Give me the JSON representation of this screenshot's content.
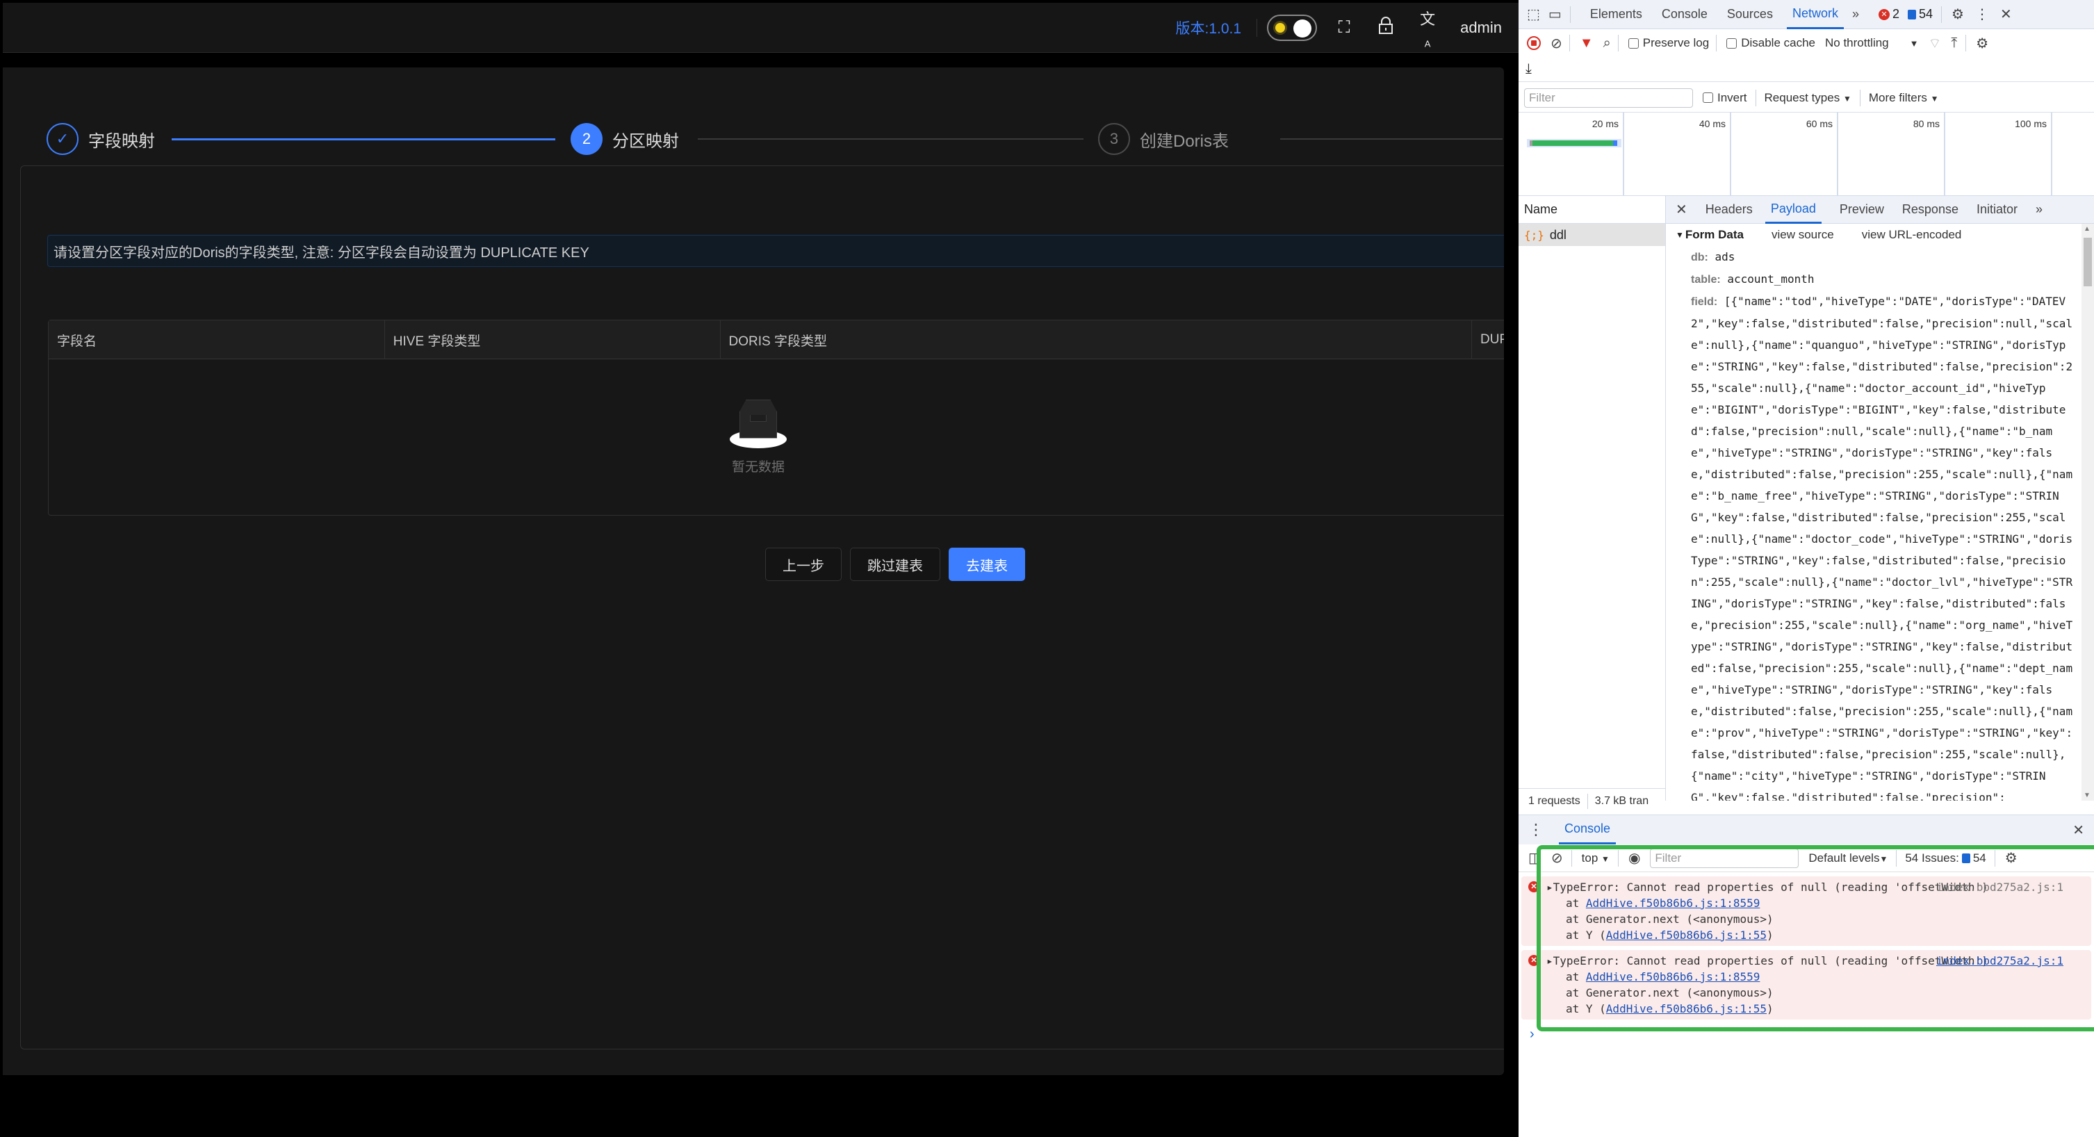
{
  "app": {
    "header": {
      "version": "版本:1.0.1",
      "theme_toggle": "light",
      "icons": [
        "fullscreen-icon",
        "lock-icon",
        "translate-icon"
      ],
      "user": "admin"
    },
    "steps": [
      {
        "index": "1",
        "label": "字段映射",
        "status": "done"
      },
      {
        "index": "2",
        "label": "分区映射",
        "status": "active"
      },
      {
        "index": "3",
        "label": "创建Doris表",
        "status": "wait"
      }
    ],
    "alert": "请设置分区字段对应的Doris的字段类型, 注意: 分区字段会自动设置为 DUPLICATE KEY",
    "table": {
      "columns": [
        "字段名",
        "HIVE 字段类型",
        "DORIS 字段类型",
        "DUPLICATE KEY"
      ],
      "rows": [],
      "empty_text": "暂无数据"
    },
    "buttons": {
      "prev": "上一步",
      "skip": "跳过建表",
      "create": "去建表"
    },
    "colors": {
      "primary": "#3c7eff",
      "background": "#171717"
    }
  },
  "devtools": {
    "tabs": [
      "Elements",
      "Console",
      "Sources",
      "Network"
    ],
    "active_tab": "Network",
    "more": "»",
    "errors_count": "2",
    "issues_count": "54",
    "toolbar": {
      "preserve_log": "Preserve log",
      "disable_cache": "Disable cache",
      "throttling": "No throttling"
    },
    "filterbar": {
      "filter_placeholder": "Filter",
      "invert": "Invert",
      "request_types": "Request types",
      "more_filters": "More filters"
    },
    "timeline": {
      "ticks": [
        "20 ms",
        "40 ms",
        "60 ms",
        "80 ms",
        "100 ms"
      ]
    },
    "requests": {
      "header": "Name",
      "items": [
        {
          "name": "ddl",
          "icon": "xhr-icon"
        }
      ],
      "status_count": "1 requests",
      "status_size": "3.7 kB tran"
    },
    "detail": {
      "tabs": [
        "Headers",
        "Payload",
        "Preview",
        "Response",
        "Initiator"
      ],
      "active_tab": "Payload",
      "form_data_title": "Form Data",
      "view_source": "view source",
      "view_url_encoded": "view URL-encoded",
      "db_key": "db:",
      "db_value": "ads",
      "table_key": "table:",
      "table_value": "account_month",
      "field_key": "field:",
      "field_value": "[{\"name\":\"tod\",\"hiveType\":\"DATE\",\"dorisType\":\"DATEV2\",\"key\":false,\"distributed\":false,\"precision\":null,\"scale\":null},{\"name\":\"quanguo\",\"hiveType\":\"STRING\",\"dorisType\":\"STRING\",\"key\":false,\"distributed\":false,\"precision\":255,\"scale\":null},{\"name\":\"doctor_account_id\",\"hiveType\":\"BIGINT\",\"dorisType\":\"BIGINT\",\"key\":false,\"distributed\":false,\"precision\":null,\"scale\":null},{\"name\":\"b_name\",\"hiveType\":\"STRING\",\"dorisType\":\"STRING\",\"key\":false,\"distributed\":false,\"precision\":255,\"scale\":null},{\"name\":\"b_name_free\",\"hiveType\":\"STRING\",\"dorisType\":\"STRING\",\"key\":false,\"distributed\":false,\"precision\":255,\"scale\":null},{\"name\":\"doctor_code\",\"hiveType\":\"STRING\",\"dorisType\":\"STRING\",\"key\":false,\"distributed\":false,\"precision\":255,\"scale\":null},{\"name\":\"doctor_lvl\",\"hiveType\":\"STRING\",\"dorisType\":\"STRING\",\"key\":false,\"distributed\":false,\"precision\":255,\"scale\":null},{\"name\":\"org_name\",\"hiveType\":\"STRING\",\"dorisType\":\"STRING\",\"key\":false,\"distributed\":false,\"precision\":255,\"scale\":null},{\"name\":\"dept_name\",\"hiveType\":\"STRING\",\"dorisType\":\"STRING\",\"key\":false,\"distributed\":false,\"precision\":255,\"scale\":null},{\"name\":\"prov\",\"hiveType\":\"STRING\",\"dorisType\":\"STRING\",\"key\":false,\"distributed\":false,\"precision\":255,\"scale\":null},{\"name\":\"city\",\"hiveType\":\"STRING\",\"dorisType\":\"STRING\",\"key\":false,\"distributed\":false,\"precision\":"
    },
    "console": {
      "title": "Console",
      "context": "top",
      "filter_placeholder": "Filter",
      "levels": "Default levels",
      "issues_label": "54 Issues:",
      "issues_count": "54",
      "messages": [
        {
          "text": "TypeError: Cannot read properties of null (reading 'offsetWidth')",
          "source": "index.bbd275a2.js:1",
          "trace": [
            {
              "prefix": "at ",
              "link": "AddHive.f50b86b6.js:1:8559",
              "suffix": ""
            },
            {
              "prefix": "at Generator.next (<anonymous>)",
              "link": "",
              "suffix": ""
            },
            {
              "prefix": "at Y (",
              "link": "AddHive.f50b86b6.js:1:55",
              "suffix": ")"
            }
          ]
        },
        {
          "text": "TypeError: Cannot read properties of null (reading 'offsetWidth')",
          "source": "index.bbd275a2.js:1",
          "trace": [
            {
              "prefix": "at ",
              "link": "AddHive.f50b86b6.js:1:8559",
              "suffix": ""
            },
            {
              "prefix": "at Generator.next (<anonymous>)",
              "link": "",
              "suffix": ""
            },
            {
              "prefix": "at Y (",
              "link": "AddHive.f50b86b6.js:1:55",
              "suffix": ")"
            }
          ]
        }
      ],
      "prompt": "›"
    },
    "annotation_color": "#3bb54a"
  }
}
